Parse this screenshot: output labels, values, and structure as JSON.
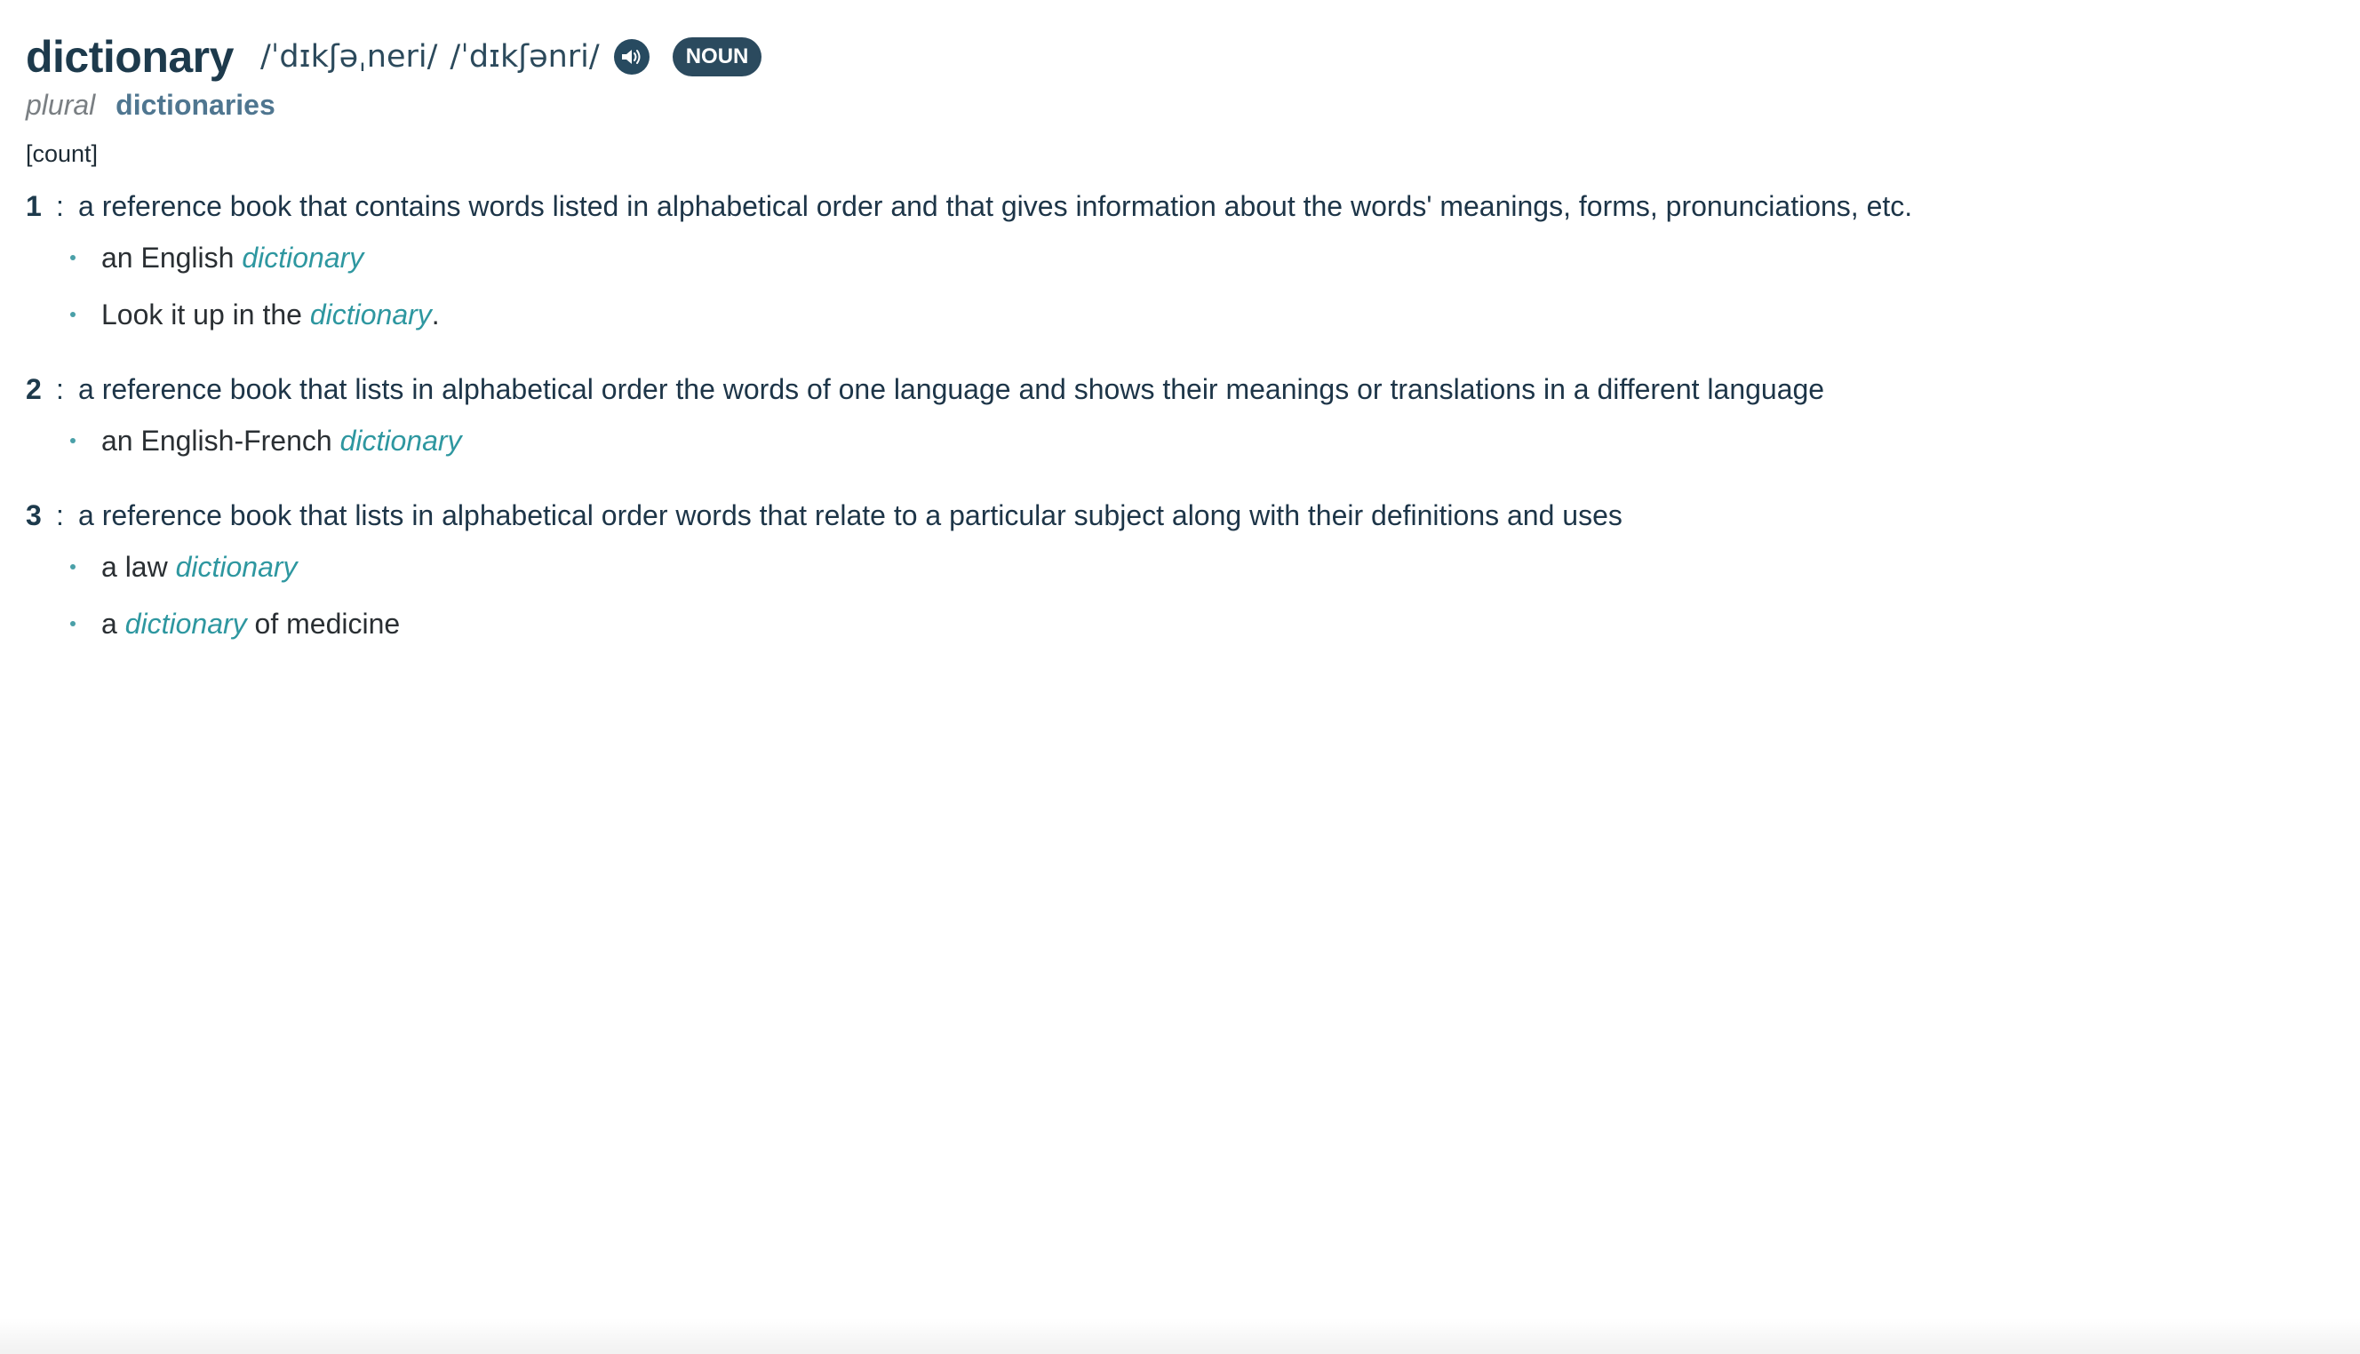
{
  "entry": {
    "headword": "dictionary",
    "pronunciations": [
      "/ˈdɪkʃəˌneri/",
      "/ˈdɪkʃənri/"
    ],
    "sound_icon": "speaker-icon",
    "part_of_speech": "NOUN",
    "plural_label": "plural",
    "plural_form": "dictionaries",
    "grammar_label": "[count]"
  },
  "senses": [
    {
      "number": "1",
      "colon": ":",
      "definition": "a reference book that contains words listed in alphabetical order and that gives information about the words' meanings, forms, pronunciations, etc.",
      "examples": [
        {
          "before": "an English ",
          "word": "dictionary",
          "after": ""
        },
        {
          "before": "Look it up in the ",
          "word": "dictionary",
          "after": "."
        }
      ]
    },
    {
      "number": "2",
      "colon": ":",
      "definition": "a reference book that lists in alphabetical order the words of one language and shows their meanings or translations in a different language",
      "examples": [
        {
          "before": "an English-French ",
          "word": "dictionary",
          "after": ""
        }
      ]
    },
    {
      "number": "3",
      "colon": ":",
      "definition": "a reference book that lists in alphabetical order words that relate to a particular subject along with their definitions and uses",
      "examples": [
        {
          "before": "a law ",
          "word": "dictionary",
          "after": ""
        },
        {
          "before": "a ",
          "word": "dictionary",
          "after": " of medicine"
        }
      ]
    }
  ],
  "colors": {
    "headword": "#1d3a4c",
    "pos_badge": "#2b4a5e",
    "example_word": "#2e97a0",
    "plural_form": "#4f7690",
    "bullet": "#4aa0a8"
  }
}
